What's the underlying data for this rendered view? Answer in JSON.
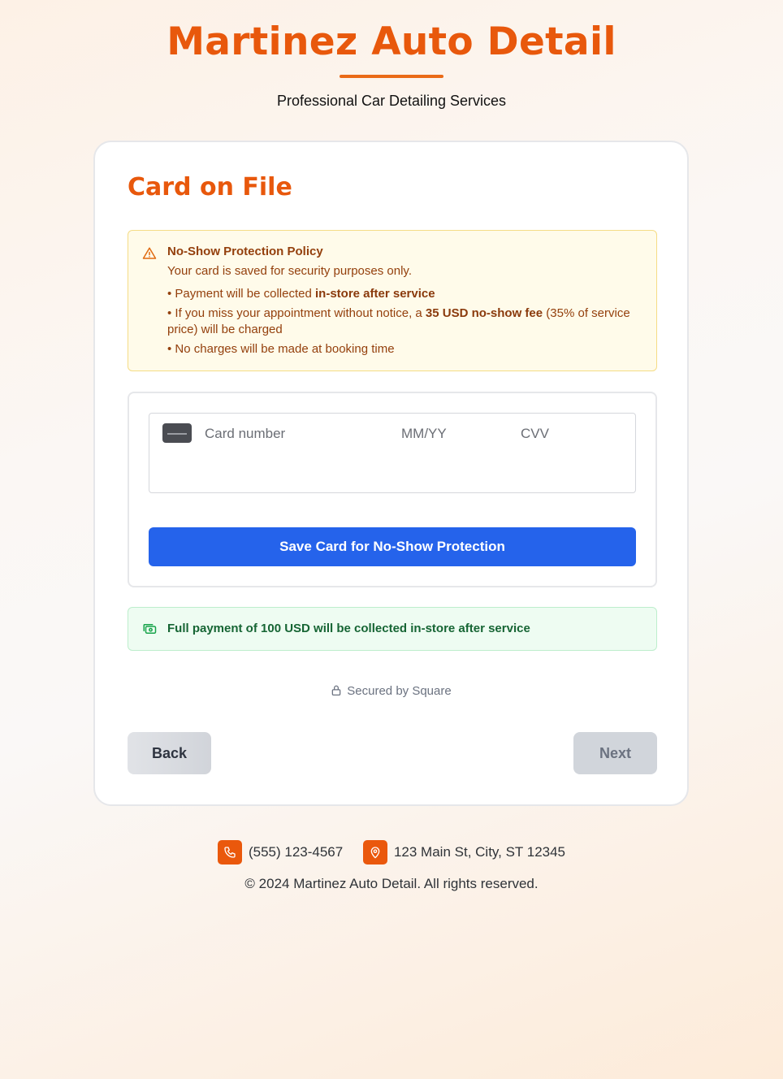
{
  "header": {
    "brand": "Martinez Auto Detail",
    "tagline": "Professional Car Detailing Services"
  },
  "card": {
    "title": "Card on File",
    "policy": {
      "icon": "warning-triangle-icon",
      "title": "No-Show Protection Policy",
      "intro": "Your card is saved for security purposes only.",
      "item1_pre": "• Payment will be collected ",
      "item1_bold": "in-store after service",
      "item2_pre": "• If you miss your appointment without notice, a ",
      "item2_bold": "35 USD no-show fee",
      "item2_post": " (35% of service price) will be charged",
      "item3": "• No charges will be made at booking time"
    },
    "payment_form": {
      "card_number_placeholder": "Card number",
      "expiry_placeholder": "MM/YY",
      "cvv_placeholder": "CVV",
      "save_button": "Save Card for No-Show Protection"
    },
    "notice": {
      "icon": "money-icon",
      "text": "Full payment of 100 USD will be collected in-store after service"
    },
    "secured_text": "Secured by Square",
    "back_button": "Back",
    "next_button": "Next"
  },
  "footer": {
    "phone": "(555) 123-4567",
    "address": "123 Main St, City, ST 12345",
    "copyright_symbol": "©",
    "copyright": "2024 Martinez Auto Detail. All rights reserved."
  },
  "colors": {
    "brand": "#e8580c",
    "primary_button": "#2563eb",
    "policy_bg": "#fffbea",
    "notice_bg": "#eefcf2"
  }
}
